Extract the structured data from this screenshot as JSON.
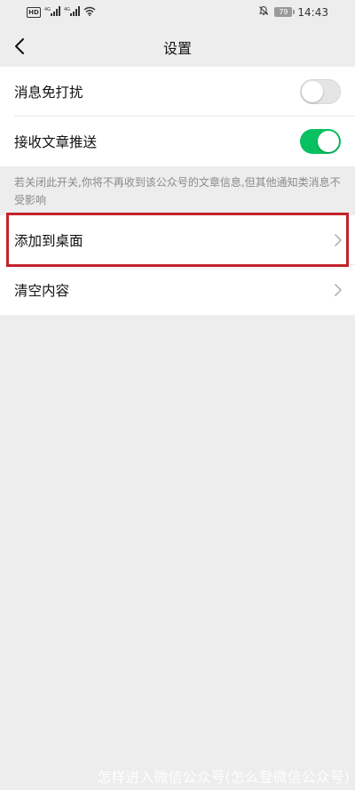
{
  "status_bar": {
    "hd_label": "HD",
    "signal1_label": "4G",
    "signal2_label": "4G",
    "battery_level": "79",
    "time": "14:43"
  },
  "nav": {
    "title": "设置",
    "back_icon": "chevron-left-icon"
  },
  "settings": {
    "do_not_disturb": {
      "label": "消息免打扰",
      "enabled": false
    },
    "receive_articles": {
      "label": "接收文章推送",
      "enabled": true
    },
    "footnote": "若关闭此开关,你将不再收到该公众号的文章信息,但其他通知类消息不受影响",
    "add_to_desktop": {
      "label": "添加到桌面"
    },
    "clear_content": {
      "label": "清空内容"
    }
  },
  "colors": {
    "toggle_on": "#07c160",
    "toggle_off": "#e5e5e5",
    "highlight": "#c4232b",
    "background": "#ededed"
  },
  "watermark": "怎样进入微信公众号(怎么登微信公众号)"
}
